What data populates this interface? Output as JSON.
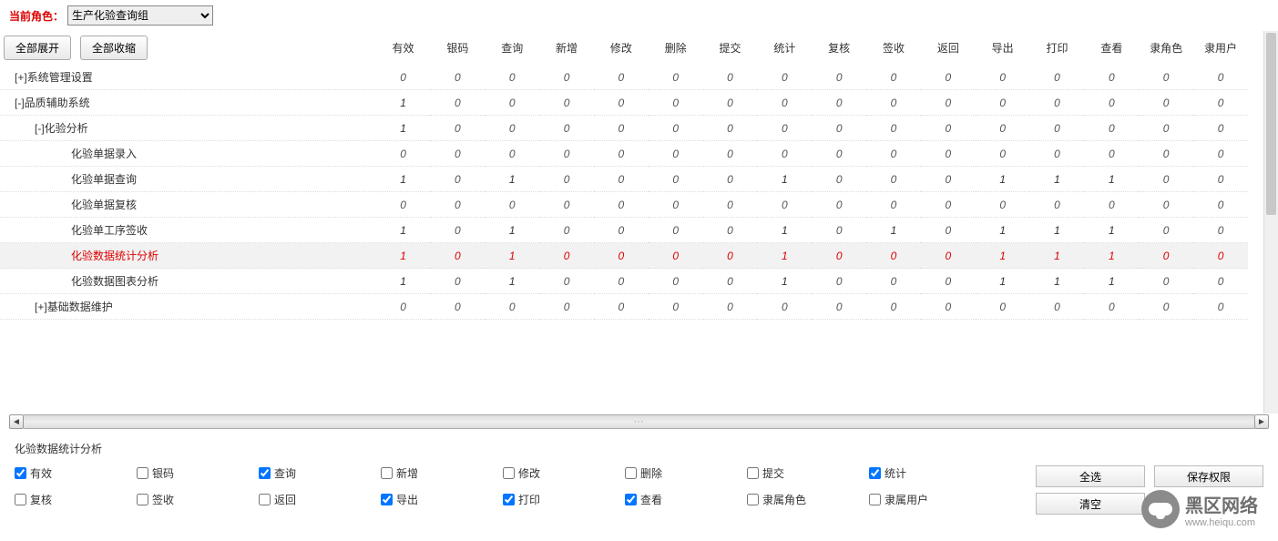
{
  "header": {
    "role_label": "当前角色：",
    "role_value": "生产化验查询组",
    "expand_all": "全部展开",
    "collapse_all": "全部收缩"
  },
  "columns": [
    "有效",
    "银码",
    "查询",
    "新增",
    "修改",
    "删除",
    "提交",
    "统计",
    "复核",
    "签收",
    "返回",
    "导出",
    "打印",
    "查看",
    "隶角色",
    "隶用户"
  ],
  "tree": [
    {
      "indent": 0,
      "toggle": "[+]",
      "label": "系统管理设置",
      "vals": [
        0,
        0,
        0,
        0,
        0,
        0,
        0,
        0,
        0,
        0,
        0,
        0,
        0,
        0,
        0,
        0
      ]
    },
    {
      "indent": 0,
      "toggle": "[-]",
      "label": "品质辅助系统",
      "vals": [
        1,
        0,
        0,
        0,
        0,
        0,
        0,
        0,
        0,
        0,
        0,
        0,
        0,
        0,
        0,
        0
      ]
    },
    {
      "indent": 1,
      "toggle": "[-]",
      "label": "化验分析",
      "vals": [
        1,
        0,
        0,
        0,
        0,
        0,
        0,
        0,
        0,
        0,
        0,
        0,
        0,
        0,
        0,
        0
      ]
    },
    {
      "indent": 2,
      "toggle": "",
      "label": "化验单据录入",
      "vals": [
        0,
        0,
        0,
        0,
        0,
        0,
        0,
        0,
        0,
        0,
        0,
        0,
        0,
        0,
        0,
        0
      ]
    },
    {
      "indent": 2,
      "toggle": "",
      "label": "化验单据查询",
      "vals": [
        1,
        0,
        1,
        0,
        0,
        0,
        0,
        1,
        0,
        0,
        0,
        1,
        1,
        1,
        0,
        0
      ]
    },
    {
      "indent": 2,
      "toggle": "",
      "label": "化验单据复核",
      "vals": [
        0,
        0,
        0,
        0,
        0,
        0,
        0,
        0,
        0,
        0,
        0,
        0,
        0,
        0,
        0,
        0
      ]
    },
    {
      "indent": 2,
      "toggle": "",
      "label": "化验单工序签收",
      "vals": [
        1,
        0,
        1,
        0,
        0,
        0,
        0,
        1,
        0,
        1,
        0,
        1,
        1,
        1,
        0,
        0
      ]
    },
    {
      "indent": 2,
      "toggle": "",
      "label": "化验数据统计分析",
      "selected": true,
      "vals": [
        1,
        0,
        1,
        0,
        0,
        0,
        0,
        1,
        0,
        0,
        0,
        1,
        1,
        1,
        0,
        0
      ]
    },
    {
      "indent": 2,
      "toggle": "",
      "label": "化验数据图表分析",
      "vals": [
        1,
        0,
        1,
        0,
        0,
        0,
        0,
        1,
        0,
        0,
        0,
        1,
        1,
        1,
        0,
        0
      ]
    },
    {
      "indent": 1,
      "toggle": "[+]",
      "label": "基础数据维护",
      "vals": [
        0,
        0,
        0,
        0,
        0,
        0,
        0,
        0,
        0,
        0,
        0,
        0,
        0,
        0,
        0,
        0
      ]
    }
  ],
  "panel": {
    "title": "化验数据统计分析",
    "perms": [
      {
        "label": "有效",
        "checked": true
      },
      {
        "label": "银码",
        "checked": false
      },
      {
        "label": "查询",
        "checked": true
      },
      {
        "label": "新增",
        "checked": false
      },
      {
        "label": "修改",
        "checked": false
      },
      {
        "label": "删除",
        "checked": false
      },
      {
        "label": "提交",
        "checked": false
      },
      {
        "label": "统计",
        "checked": true
      },
      {
        "label": "复核",
        "checked": false
      },
      {
        "label": "签收",
        "checked": false
      },
      {
        "label": "返回",
        "checked": false
      },
      {
        "label": "导出",
        "checked": true
      },
      {
        "label": "打印",
        "checked": true
      },
      {
        "label": "查看",
        "checked": true
      },
      {
        "label": "隶属角色",
        "checked": false
      },
      {
        "label": "隶属用户",
        "checked": false
      }
    ],
    "buttons": {
      "select_all": "全选",
      "save": "保存权限",
      "clear": "清空"
    }
  },
  "watermark": {
    "title": "黑区网络",
    "sub": "www.heiqu.com"
  }
}
